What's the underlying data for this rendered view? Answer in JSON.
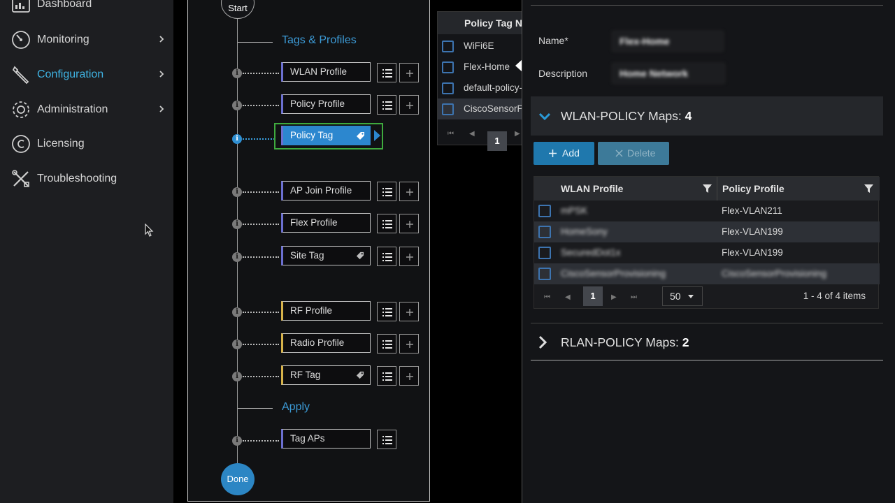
{
  "sidebar": {
    "items": [
      {
        "label": "Dashboard",
        "icon": "dashboard-icon"
      },
      {
        "label": "Monitoring",
        "icon": "gauge-icon",
        "has_arrow": true
      },
      {
        "label": "Configuration",
        "icon": "wrench-icon",
        "has_arrow": true,
        "active": true
      },
      {
        "label": "Administration",
        "icon": "gear-icon",
        "has_arrow": true
      },
      {
        "label": "Licensing",
        "icon": "copyright-icon"
      },
      {
        "label": "Troubleshooting",
        "icon": "tools-icon"
      }
    ]
  },
  "workflow": {
    "start_label": "Start",
    "done_label": "Done",
    "section_tags": "Tags & Profiles",
    "section_apply": "Apply",
    "steps": {
      "wlan_profile": "WLAN Profile",
      "policy_profile": "Policy Profile",
      "policy_tag": "Policy Tag",
      "ap_join_profile": "AP Join Profile",
      "flex_profile": "Flex Profile",
      "site_tag": "Site Tag",
      "rf_profile": "RF Profile",
      "radio_profile": "Radio Profile",
      "rf_tag": "RF Tag",
      "tag_aps": "Tag APs"
    }
  },
  "policy_tag_table": {
    "header": "Policy Tag Name",
    "rows": [
      "WiFi6E",
      "Flex-Home",
      "default-policy-tag",
      "CiscoSensorProvisioning"
    ],
    "page": "1"
  },
  "edit_panel": {
    "name_label": "Name*",
    "name_value": "Flex-Home",
    "description_label": "Description",
    "description_value": "Home Network",
    "wlan_maps_title": "WLAN-POLICY Maps:",
    "wlan_maps_count": "4",
    "add_label": "Add",
    "delete_label": "Delete",
    "columns": [
      "WLAN Profile",
      "Policy Profile"
    ],
    "rows": [
      {
        "wlan": "mPSK",
        "policy": "Flex-VLAN211"
      },
      {
        "wlan": "HomeSony",
        "policy": "Flex-VLAN199"
      },
      {
        "wlan": "SecuredDot1x",
        "policy": "Flex-VLAN199"
      },
      {
        "wlan": "CiscoSensorProvisioning",
        "policy": "CiscoSensorProvisioning"
      }
    ],
    "page": "1",
    "per_page": "50",
    "items_text": "1 - 4 of 4 items",
    "rlan_maps_title": "RLAN-POLICY Maps:",
    "rlan_maps_count": "2"
  },
  "colors": {
    "accent": "#3fb3e3",
    "primary_button": "#1f78ad",
    "selected_step": "#2c87cf",
    "highlight_border": "#3faa3e"
  }
}
